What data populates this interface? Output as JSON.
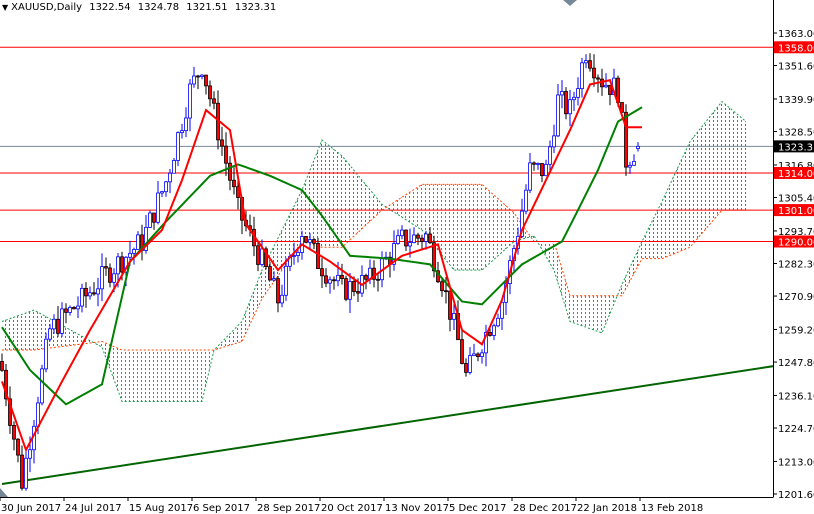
{
  "header": {
    "symbol": "XAUUSD,Daily",
    "open": "1322.54",
    "high": "1324.78",
    "low": "1321.51",
    "close": "1323.31"
  },
  "chart_data": {
    "type": "candlestick",
    "title": "XAUUSD,Daily",
    "ylim": [
      1201.6,
      1363.0
    ],
    "y_ticks": [
      "1363.00",
      "1351.60",
      "1339.90",
      "1328.50",
      "1316.80",
      "1305.40",
      "1293.70",
      "1282.30",
      "1270.90",
      "1259.20",
      "1247.80",
      "1236.10",
      "1224.70",
      "1213.00",
      "1201.60"
    ],
    "x_ticks": [
      {
        "bar": 0,
        "label": "30 Jun 2017"
      },
      {
        "bar": 16,
        "label": "24 Jul 2017"
      },
      {
        "bar": 32,
        "label": "15 Aug 2017"
      },
      {
        "bar": 48,
        "label": "6 Sep 2017"
      },
      {
        "bar": 64,
        "label": "28 Sep 2017"
      },
      {
        "bar": 80,
        "label": "20 Oct 2017"
      },
      {
        "bar": 96,
        "label": "13 Nov 2017"
      },
      {
        "bar": 112,
        "label": "5 Dec 2017"
      },
      {
        "bar": 128,
        "label": "28 Dec 2017"
      },
      {
        "bar": 144,
        "label": "22 Jan 2018"
      },
      {
        "bar": 160,
        "label": "13 Feb 2018"
      }
    ],
    "close_keypoints": [
      [
        0,
        1245
      ],
      [
        5,
        1206
      ],
      [
        12,
        1259
      ],
      [
        20,
        1269.5
      ],
      [
        27,
        1280
      ],
      [
        35,
        1290
      ],
      [
        41,
        1311
      ],
      [
        47,
        1343
      ],
      [
        50,
        1352
      ],
      [
        54,
        1329
      ],
      [
        59,
        1301
      ],
      [
        65,
        1283
      ],
      [
        69,
        1269.5
      ],
      [
        75,
        1294
      ],
      [
        79,
        1283
      ],
      [
        85,
        1273
      ],
      [
        92,
        1276.5
      ],
      [
        100,
        1290.5
      ],
      [
        106,
        1292
      ],
      [
        110,
        1276.5
      ],
      [
        114,
        1255
      ],
      [
        116,
        1243
      ],
      [
        120,
        1255
      ],
      [
        125,
        1269.5
      ],
      [
        129,
        1294
      ],
      [
        132,
        1315
      ],
      [
        136,
        1315
      ],
      [
        139,
        1339.5
      ],
      [
        142,
        1336
      ],
      [
        146,
        1357
      ],
      [
        150,
        1346.5
      ],
      [
        154,
        1343
      ],
      [
        156,
        1318.5
      ],
      [
        159,
        1323.31
      ]
    ],
    "last_bar": {
      "open": 1322.54,
      "high": 1324.78,
      "low": 1321.51,
      "close": 1323.31
    },
    "tenkan_sen": [
      [
        0,
        1241
      ],
      [
        6,
        1217
      ],
      [
        15,
        1241
      ],
      [
        22,
        1259
      ],
      [
        32,
        1283
      ],
      [
        40,
        1294
      ],
      [
        45,
        1311.5
      ],
      [
        51,
        1336
      ],
      [
        57,
        1329
      ],
      [
        61,
        1296
      ],
      [
        69,
        1280
      ],
      [
        75,
        1289
      ],
      [
        82,
        1283
      ],
      [
        90,
        1274.8
      ],
      [
        100,
        1285
      ],
      [
        109,
        1289
      ],
      [
        115,
        1259
      ],
      [
        120,
        1254
      ],
      [
        125,
        1269.5
      ],
      [
        130,
        1294
      ],
      [
        136,
        1311.5
      ],
      [
        142,
        1329
      ],
      [
        147,
        1345
      ],
      [
        152,
        1346.5
      ],
      [
        156,
        1330
      ],
      [
        160,
        1330
      ]
    ],
    "kijun_sen": [
      [
        0,
        1260
      ],
      [
        7,
        1245
      ],
      [
        16,
        1233
      ],
      [
        25,
        1240
      ],
      [
        32,
        1283
      ],
      [
        41,
        1297
      ],
      [
        52,
        1313
      ],
      [
        59,
        1317
      ],
      [
        67,
        1313
      ],
      [
        75,
        1308
      ],
      [
        80,
        1299
      ],
      [
        87,
        1285
      ],
      [
        97,
        1284
      ],
      [
        107,
        1282
      ],
      [
        115,
        1269
      ],
      [
        120,
        1268
      ],
      [
        130,
        1282
      ],
      [
        140,
        1290
      ],
      [
        144,
        1301
      ],
      [
        149,
        1315
      ],
      [
        154,
        1332
      ],
      [
        160,
        1337
      ]
    ],
    "ichimoku_cloud": {
      "span_a": [
        [
          0,
          1262
        ],
        [
          8,
          1266
        ],
        [
          25,
          1253
        ],
        [
          30,
          1234
        ],
        [
          50,
          1234
        ],
        [
          53,
          1252
        ],
        [
          60,
          1262
        ],
        [
          65,
          1280
        ],
        [
          75,
          1308
        ],
        [
          80,
          1325.5
        ],
        [
          85,
          1320
        ],
        [
          95,
          1303
        ],
        [
          105,
          1294
        ],
        [
          113,
          1280
        ],
        [
          120,
          1280
        ],
        [
          128,
          1290
        ],
        [
          133,
          1292
        ],
        [
          138,
          1280
        ],
        [
          142,
          1262
        ],
        [
          150,
          1258
        ],
        [
          155,
          1275
        ],
        [
          160,
          1290
        ],
        [
          165,
          1304
        ],
        [
          172,
          1325
        ],
        [
          180,
          1339
        ],
        [
          186,
          1332
        ]
      ],
      "span_b": [
        [
          0,
          1252
        ],
        [
          8,
          1252
        ],
        [
          25,
          1255
        ],
        [
          30,
          1252
        ],
        [
          50,
          1252
        ],
        [
          53,
          1252
        ],
        [
          60,
          1255
        ],
        [
          65,
          1270
        ],
        [
          75,
          1290
        ],
        [
          80,
          1288
        ],
        [
          85,
          1288
        ],
        [
          95,
          1301
        ],
        [
          105,
          1310
        ],
        [
          113,
          1310
        ],
        [
          120,
          1310
        ],
        [
          128,
          1300
        ],
        [
          133,
          1290
        ],
        [
          138,
          1290
        ],
        [
          142,
          1271
        ],
        [
          150,
          1271
        ],
        [
          155,
          1271
        ],
        [
          160,
          1284
        ],
        [
          165,
          1284
        ],
        [
          172,
          1288
        ],
        [
          180,
          1301
        ],
        [
          186,
          1301
        ]
      ],
      "bull_color": "#1a9a4a",
      "bear_color": "#ff4500"
    },
    "horizontal_levels": [
      {
        "price": 1358.0,
        "label": "1358.00",
        "color": "#ff0000"
      },
      {
        "price": 1314.0,
        "label": "1314.00",
        "color": "#ff0000"
      },
      {
        "price": 1301.0,
        "label": "1301.00",
        "color": "#ff0000"
      },
      {
        "price": 1290.0,
        "label": "1290.00",
        "color": "#ff0000"
      }
    ],
    "current_price": {
      "price": 1323.31,
      "label": "1323.31",
      "color": "#778899"
    },
    "trendline": {
      "from": [
        0,
        1205.1
      ],
      "to": [
        193,
        1246.4
      ],
      "color": "#006400"
    },
    "colors": {
      "bull": "#0000ff",
      "bear_body": "#ff0000",
      "bear_wick": "#000000",
      "tenkan": "#ff0000",
      "kijun": "#008000"
    }
  }
}
